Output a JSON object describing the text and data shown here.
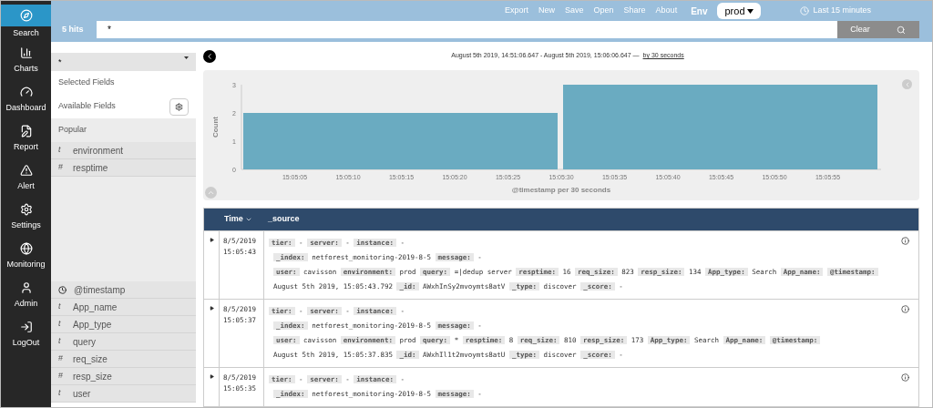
{
  "sidebar": {
    "items": [
      {
        "label": "Search",
        "selected": true
      },
      {
        "label": "Charts",
        "selected": false
      },
      {
        "label": "Dashboard",
        "selected": false
      },
      {
        "label": "Report",
        "selected": false
      },
      {
        "label": "Alert",
        "selected": false
      },
      {
        "label": "Settings",
        "selected": false
      },
      {
        "label": "Monitoring",
        "selected": false
      },
      {
        "label": "Admin",
        "selected": false
      },
      {
        "label": "LogOut",
        "selected": false
      }
    ]
  },
  "top_menu": [
    "Export",
    "New",
    "Save",
    "Open",
    "Share",
    "About"
  ],
  "env": {
    "label": "Env",
    "value": "prod"
  },
  "time_range": "Last 15 minutes",
  "search": {
    "hits": "5 hits",
    "value": "*",
    "clear": "Clear"
  },
  "field_panel": {
    "index_pattern": "*",
    "selected_fields": "Selected Fields",
    "available_fields": "Available Fields",
    "popular": "Popular",
    "popular_fields": [
      {
        "kind": "string",
        "mark": "t",
        "name": "environment"
      },
      {
        "kind": "number",
        "mark": "#",
        "name": "resptime"
      }
    ],
    "fields": [
      {
        "kind": "date",
        "name": "@timestamp"
      },
      {
        "kind": "string",
        "mark": "t",
        "name": "App_name"
      },
      {
        "kind": "string",
        "mark": "t",
        "name": "App_type"
      },
      {
        "kind": "string",
        "mark": "t",
        "name": "query"
      },
      {
        "kind": "number",
        "mark": "#",
        "name": "req_size"
      },
      {
        "kind": "number",
        "mark": "#",
        "name": "resp_size"
      },
      {
        "kind": "string",
        "mark": "t",
        "name": "user"
      }
    ]
  },
  "range_text": "August 5th 2019, 14:51:06.647 - August 5th 2019, 15:06:06.647 —",
  "interval_link": "by 30 seconds",
  "chart_data": {
    "type": "bar",
    "xlabel": "@timestamp per 30 seconds",
    "ylabel": "Count",
    "x": [
      54315,
      54345
    ],
    "values": [
      2,
      3
    ],
    "xlim": [
      54300,
      54360
    ],
    "ylim": [
      0,
      3
    ],
    "yticks": [
      0,
      1,
      2,
      3
    ],
    "xticks": [
      {
        "value": 54305,
        "label": "15:05:05"
      },
      {
        "value": 54310,
        "label": "15:05:10"
      },
      {
        "value": 54315,
        "label": "15:05:15"
      },
      {
        "value": 54320,
        "label": "15:05:20"
      },
      {
        "value": 54325,
        "label": "15:05:25"
      },
      {
        "value": 54330,
        "label": "15:05:30"
      },
      {
        "value": 54335,
        "label": "15:05:35"
      },
      {
        "value": 54340,
        "label": "15:05:40"
      },
      {
        "value": 54345,
        "label": "15:05:45"
      },
      {
        "value": 54350,
        "label": "15:05:50"
      },
      {
        "value": 54355,
        "label": "15:05:55"
      }
    ]
  },
  "table": {
    "columns": [
      "Time",
      "_source"
    ],
    "rows": [
      {
        "date": "8/5/2019",
        "time": "15:05:43",
        "lines": [
          [
            {
              "key": "tier:",
              "value": "-"
            },
            {
              "key": "server:",
              "value": "-"
            },
            {
              "key": "instance:",
              "value": "-"
            }
          ],
          [
            {
              "key": "_index:",
              "value": "netforest_monitoring-2019-8-5"
            },
            {
              "key": "message:",
              "value": "-"
            }
          ],
          [
            {
              "key": "user:",
              "value": "cavisson"
            },
            {
              "key": "environment:",
              "value": "prod"
            },
            {
              "key": "query:",
              "value": "=|dedup server"
            },
            {
              "key": "resptime:",
              "value": "16"
            },
            {
              "key": "req_size:",
              "value": "823"
            },
            {
              "key": "resp_size:",
              "value": "134"
            },
            {
              "key": "App_type:",
              "value": "Search"
            },
            {
              "key": "App_name:"
            },
            {
              "key": "@timestamp:",
              "value": "August 5th 2019, 15:05:43.792"
            },
            {
              "key": "_id:",
              "value": "AWxhInSy2mvoymts8atV"
            },
            {
              "key": "_type:",
              "value": "discover"
            },
            {
              "key": "_score:",
              "value": "-"
            }
          ]
        ]
      },
      {
        "date": "8/5/2019",
        "time": "15:05:37",
        "lines": [
          [
            {
              "key": "tier:",
              "value": "-"
            },
            {
              "key": "server:",
              "value": "-"
            },
            {
              "key": "instance:",
              "value": "-"
            }
          ],
          [
            {
              "key": "_index:",
              "value": "netforest_monitoring-2019-8-5"
            },
            {
              "key": "message:",
              "value": "-"
            }
          ],
          [
            {
              "key": "user:",
              "value": "cavisson"
            },
            {
              "key": "environment:",
              "value": "prod"
            },
            {
              "key": "query:",
              "value": "*"
            },
            {
              "key": "resptime:",
              "value": "8"
            },
            {
              "key": "req_size:",
              "value": "810"
            },
            {
              "key": "resp_size:",
              "value": "173"
            },
            {
              "key": "App_type:",
              "value": "Search"
            },
            {
              "key": "App_name:"
            },
            {
              "key": "@timestamp:",
              "value": "August 5th 2019, 15:05:37.835"
            },
            {
              "key": "_id:",
              "value": "AWxhIl1t2mvoymts8atU"
            },
            {
              "key": "_type:",
              "value": "discover"
            },
            {
              "key": "_score:",
              "value": "-"
            }
          ]
        ]
      },
      {
        "date": "8/5/2019",
        "time": "15:05:35",
        "lines": [
          [
            {
              "key": "tier:",
              "value": "-"
            },
            {
              "key": "server:",
              "value": "-"
            },
            {
              "key": "instance:",
              "value": "-"
            }
          ],
          [
            {
              "key": "_index:",
              "value": "netforest_monitoring-2019-8-5"
            },
            {
              "key": "message:",
              "value": "-"
            }
          ]
        ]
      }
    ]
  }
}
